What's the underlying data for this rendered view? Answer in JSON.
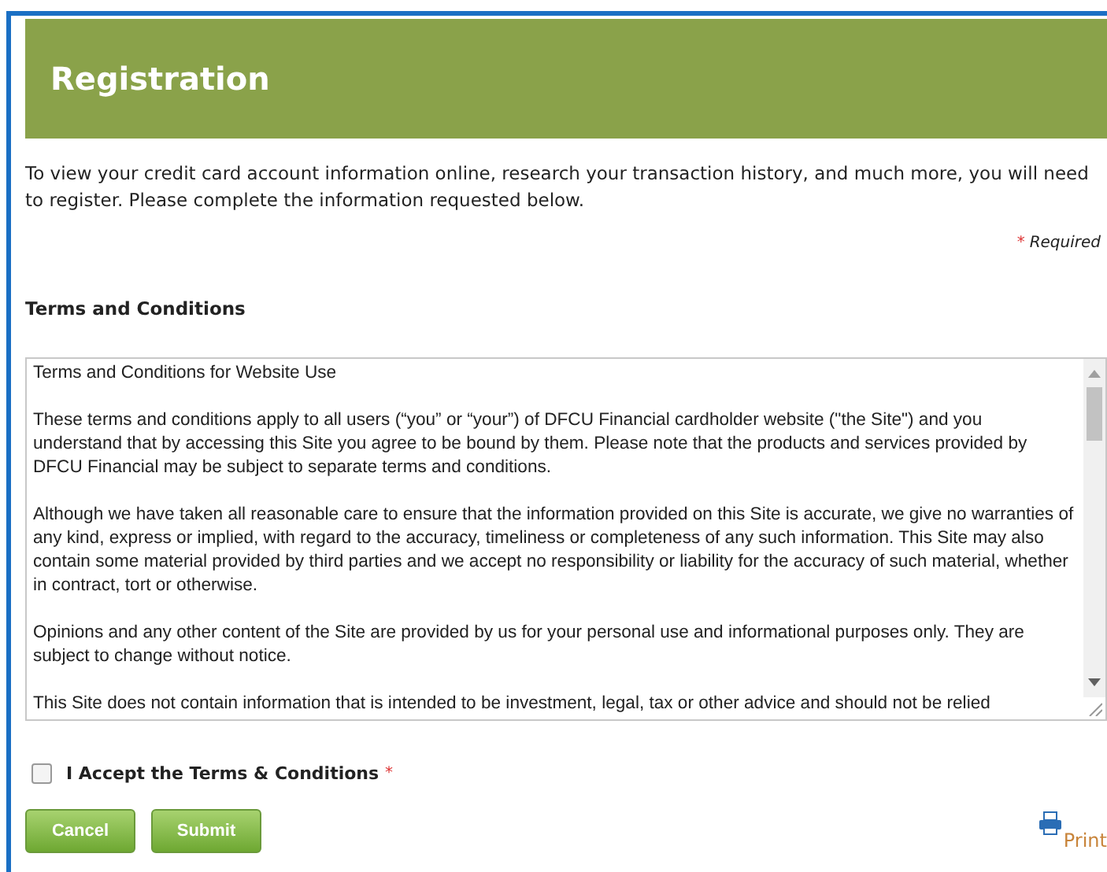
{
  "header": {
    "title": "Registration"
  },
  "intro": "To view your credit card account information online, research your transaction history, and much more, you will need to register. Please complete the information requested below.",
  "required_note": {
    "mark": "*",
    "label": "Required"
  },
  "terms": {
    "heading": "Terms and Conditions",
    "paragraphs": [
      "Terms and Conditions for Website Use",
      "These terms and conditions apply to all users (“you” or “your”) of DFCU Financial cardholder website (\"the Site\") and you understand that by accessing this Site you agree to be bound by them. Please note that the products and services provided by DFCU Financial may be subject to separate terms and conditions.",
      "Although we have taken all reasonable care to ensure that the information provided on this Site is accurate, we give no warranties of any kind, express or implied, with regard to the accuracy, timeliness or completeness of any such information. This Site may also contain some material provided by third parties and we accept no responsibility or liability for the accuracy of such material, whether in contract, tort or otherwise.",
      "Opinions and any other content of the Site are provided by us for your personal use and informational purposes only. They are subject to change without notice.",
      "This Site does not contain information that is intended to be investment, legal, tax or other advice and should not be relied"
    ]
  },
  "accept": {
    "label": "I Accept the Terms & Conditions",
    "mark": "*",
    "checked": false
  },
  "buttons": [
    "Cancel",
    "Submit"
  ],
  "print": "Print"
}
